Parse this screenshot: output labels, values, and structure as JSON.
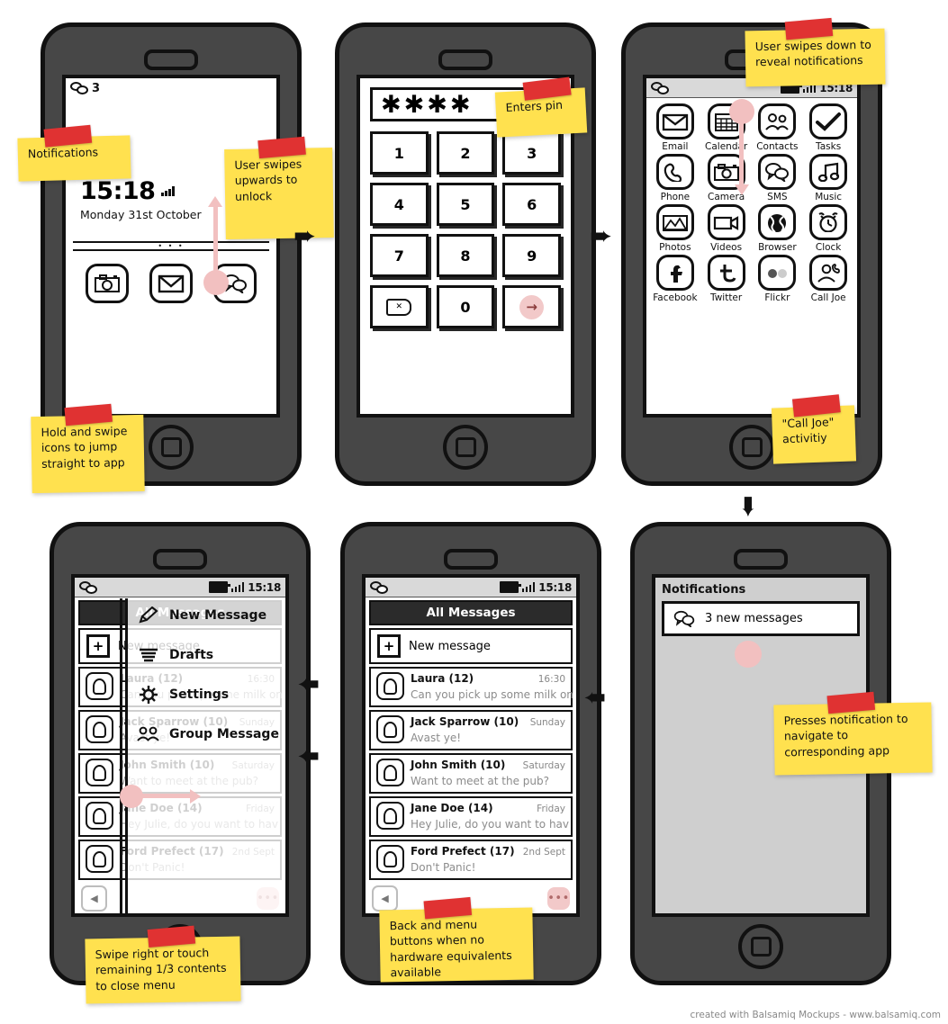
{
  "colors": {
    "note": "#FFE14F",
    "tape": "#E03232",
    "phone_body": "#474747",
    "accent_pink": "#F2C0C0",
    "status_bar": "#D9D9D9",
    "title_bar": "#2B2B2B"
  },
  "credit": "created with Balsamiq Mockups - www.balsamiq.com",
  "phone1": {
    "name": "lock-screen",
    "status": {
      "chat_count": "3"
    },
    "time": "15:18",
    "date": "Monday 31st October",
    "dock_dots": "• • •",
    "dock": [
      {
        "icon": "camera-icon",
        "label": "Camera"
      },
      {
        "icon": "email-icon",
        "label": "Email"
      },
      {
        "icon": "sms-icon",
        "label": "SMS"
      }
    ]
  },
  "phone2": {
    "name": "pin-screen",
    "pin_value": "✱✱✱✱",
    "keys": [
      "1",
      "2",
      "3",
      "4",
      "5",
      "6",
      "7",
      "8",
      "9",
      "⌫",
      "0",
      "→"
    ]
  },
  "phone3": {
    "name": "home-screen",
    "status": {
      "time": "15:18"
    },
    "apps": [
      {
        "label": "Email",
        "icon": "email-icon"
      },
      {
        "label": "Calendar",
        "icon": "calendar-icon"
      },
      {
        "label": "Contacts",
        "icon": "contacts-icon"
      },
      {
        "label": "Tasks",
        "icon": "check-icon"
      },
      {
        "label": "Phone",
        "icon": "phone-icon"
      },
      {
        "label": "Camera",
        "icon": "camera-icon"
      },
      {
        "label": "SMS",
        "icon": "sms-icon"
      },
      {
        "label": "Music",
        "icon": "music-icon"
      },
      {
        "label": "Photos",
        "icon": "photos-icon"
      },
      {
        "label": "Videos",
        "icon": "video-icon"
      },
      {
        "label": "Browser",
        "icon": "globe-icon"
      },
      {
        "label": "Clock",
        "icon": "clock-icon"
      },
      {
        "label": "Facebook",
        "icon": "facebook-icon"
      },
      {
        "label": "Twitter",
        "icon": "twitter-icon"
      },
      {
        "label": "Flickr",
        "icon": "flickr-icon"
      },
      {
        "label": "Call Joe",
        "icon": "call-contact-icon"
      }
    ]
  },
  "phone4": {
    "name": "messages-with-menu",
    "status": {
      "time": "15:18"
    },
    "title": "All Messages",
    "new_message": "New message",
    "menu": [
      {
        "label": "New Message",
        "icon": "pencil-icon"
      },
      {
        "label": "Drafts",
        "icon": "lines-icon"
      },
      {
        "label": "Settings",
        "icon": "gear-icon"
      },
      {
        "label": "Group Message",
        "icon": "group-icon"
      }
    ]
  },
  "phone5": {
    "name": "messages-list",
    "status": {
      "time": "15:18"
    },
    "title": "All Messages",
    "new_message": "New message",
    "back_label": "◀",
    "menu_label": "•••"
  },
  "messages": [
    {
      "name": "Laura (12)",
      "date": "16:30",
      "preview": "Can you pick up some milk on t"
    },
    {
      "name": "Jack Sparrow (10)",
      "date": "Sunday",
      "preview": "Avast ye!"
    },
    {
      "name": "John Smith (10)",
      "date": "Saturday",
      "preview": "Want to meet at the pub?"
    },
    {
      "name": "Jane Doe (14)",
      "date": "Friday",
      "preview": "Hey Julie, do you want to hav"
    },
    {
      "name": "Ford Prefect (17)",
      "date": "2nd Sept",
      "preview": "Don't Panic!"
    }
  ],
  "phone6": {
    "name": "notifications-screen",
    "title": "Notifications",
    "item": "3 new messages"
  },
  "notes": [
    {
      "id": "note-notifications",
      "text": "Notifications"
    },
    {
      "id": "note-swipe-unlock",
      "text": "User swipes upwards to unlock"
    },
    {
      "id": "note-hold-swipe",
      "text": "Hold and swipe icons to jump straight to app"
    },
    {
      "id": "note-enters-pin",
      "text": "Enters pin"
    },
    {
      "id": "note-swipe-down",
      "text": "User swipes down to reveal notifications"
    },
    {
      "id": "note-call-joe",
      "text": "\"Call Joe\" activitiy"
    },
    {
      "id": "note-close-menu",
      "text": "Swipe right or touch remaining 1/3 contents to close menu"
    },
    {
      "id": "note-back-menu",
      "text": "Back and menu buttons when no hardware equivalents available"
    },
    {
      "id": "note-press-notification",
      "text": "Presses notification to navigate to corresponding app"
    }
  ]
}
